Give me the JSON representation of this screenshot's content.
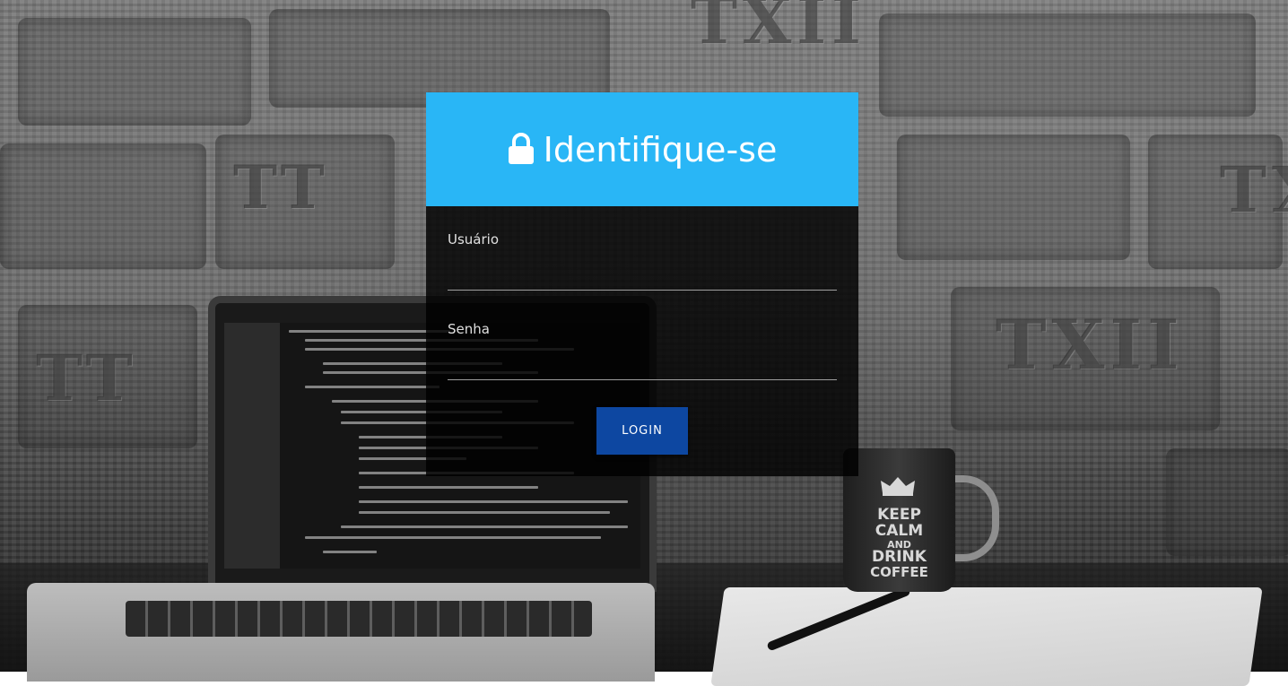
{
  "header": {
    "title": "Identifique-se",
    "icon": "lock-icon",
    "background_color": "#29b6f6"
  },
  "form": {
    "username_label": "Usuário",
    "username_value": "",
    "password_label": "Senha",
    "password_value": "",
    "submit_label": "LOGIN",
    "submit_color": "#0d47a1"
  },
  "background": {
    "wall_marks": [
      "TXII",
      "TXII",
      "TT",
      "TT",
      "TXII"
    ],
    "mug_text": [
      "KEEP",
      "CALM",
      "AND",
      "DRINK",
      "COFFEE"
    ]
  }
}
